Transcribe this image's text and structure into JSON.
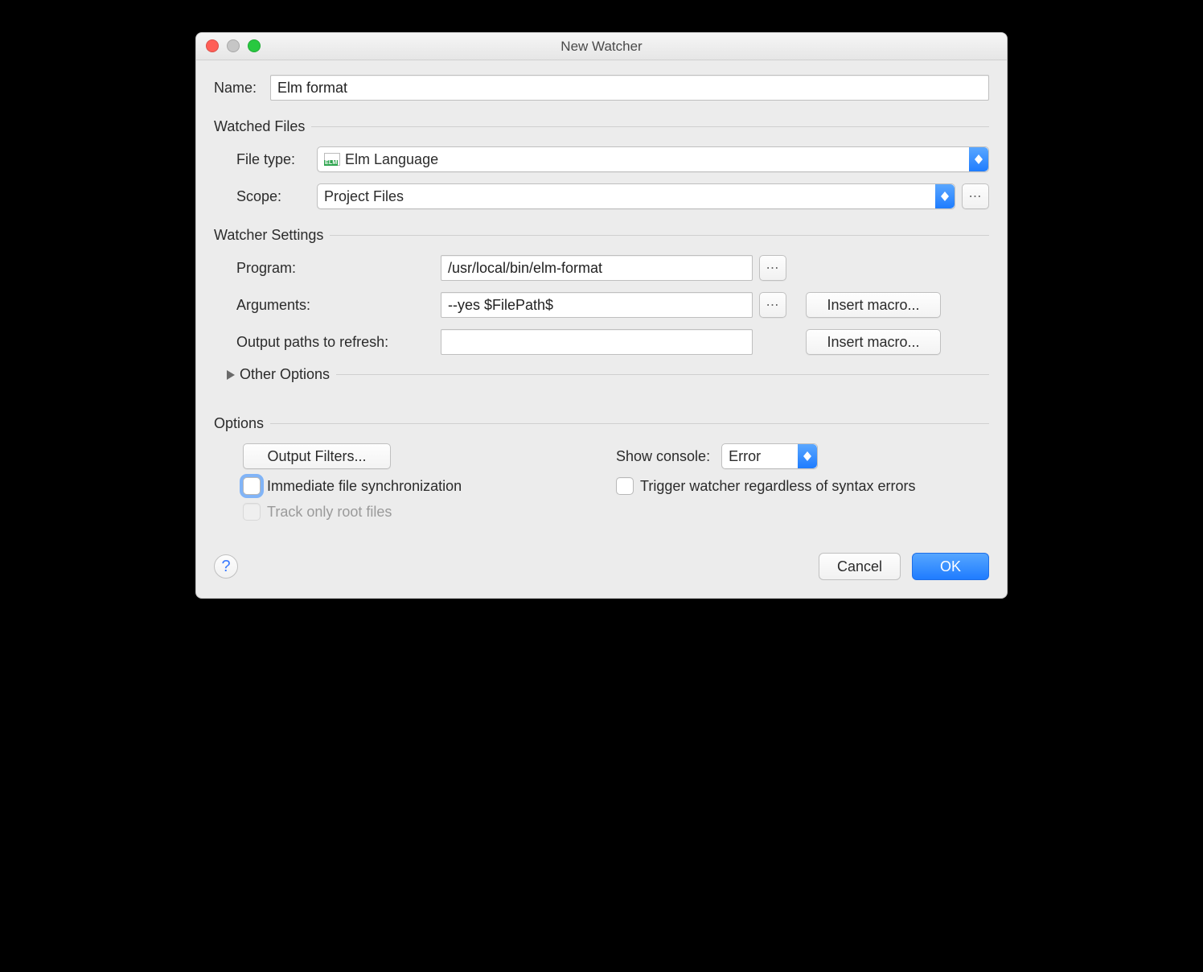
{
  "window": {
    "title": "New Watcher"
  },
  "name": {
    "label": "Name:",
    "value": "Elm format"
  },
  "watched_files": {
    "title": "Watched Files",
    "file_type": {
      "label": "File type:",
      "value": "Elm Language",
      "icon": "elm-file-icon"
    },
    "scope": {
      "label": "Scope:",
      "value": "Project Files"
    }
  },
  "watcher_settings": {
    "title": "Watcher Settings",
    "program": {
      "label": "Program:",
      "value": "/usr/local/bin/elm-format"
    },
    "arguments": {
      "label": "Arguments:",
      "value": "--yes $FilePath$",
      "macro_btn": "Insert macro..."
    },
    "output_paths": {
      "label": "Output paths to refresh:",
      "value": "",
      "macro_btn": "Insert macro..."
    },
    "other_options": "Other Options"
  },
  "options": {
    "title": "Options",
    "output_filters": "Output Filters...",
    "show_console": {
      "label": "Show console:",
      "value": "Error"
    },
    "immediate_sync": {
      "label": "Immediate file synchronization",
      "checked": false,
      "focused": true
    },
    "trigger_regardless": {
      "label": "Trigger watcher regardless of syntax errors",
      "checked": false
    },
    "track_only_root": {
      "label": "Track only root files",
      "checked": false,
      "disabled": true
    }
  },
  "footer": {
    "cancel": "Cancel",
    "ok": "OK"
  },
  "colors": {
    "accent": "#1f7cff"
  }
}
